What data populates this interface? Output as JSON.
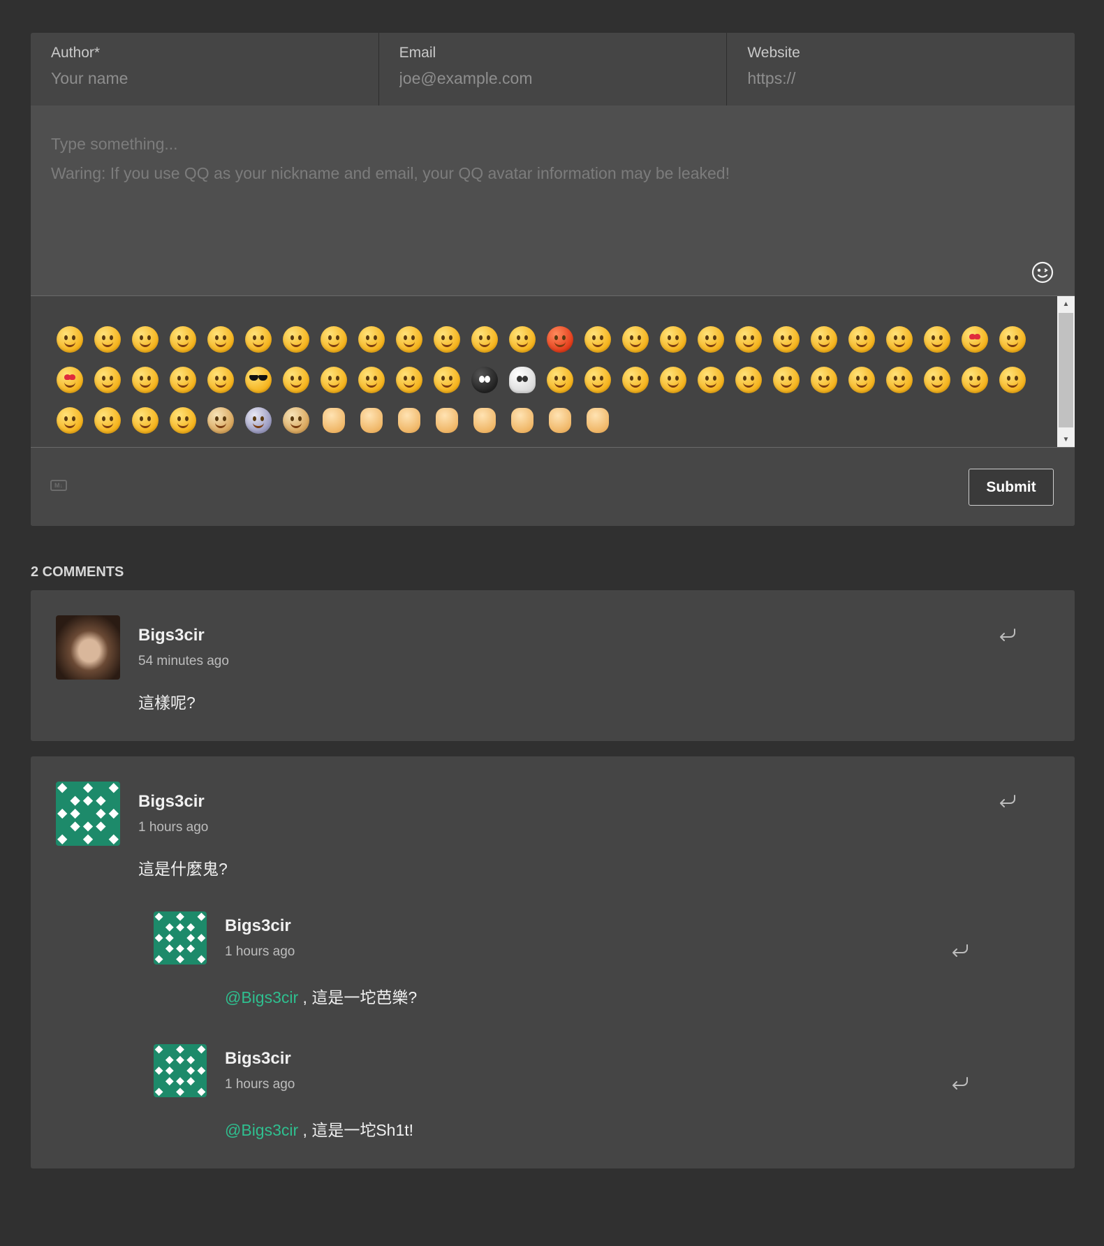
{
  "form": {
    "fields": [
      {
        "label": "Author*",
        "placeholder": "Your name"
      },
      {
        "label": "Email",
        "placeholder": "joe@example.com"
      },
      {
        "label": "Website",
        "placeholder": "https://"
      }
    ],
    "textarea_placeholder": "Type something...\nWaring: If you use QQ as your nickname and email, your QQ avatar information may be leaked!",
    "emoji_toggle_icon": "smiley-face-icon",
    "markdown_icon": "markdown-icon",
    "submit_label": "Submit"
  },
  "emoji_panel": {
    "scroll_position": 0,
    "emoji_count": 67
  },
  "comments": {
    "count_label": "2 COMMENTS",
    "accent_color": "#2fbf8f",
    "items": [
      {
        "author": "Bigs3cir",
        "time": "54 minutes ago",
        "avatar": "photo-avatar",
        "text": "這樣呢?"
      },
      {
        "author": "Bigs3cir",
        "time": "1 hours ago",
        "avatar": "identicon-avatar",
        "text": "這是什麼鬼?",
        "replies": [
          {
            "author": "Bigs3cir",
            "time": "1 hours ago",
            "mention": "@Bigs3cir",
            "text": " , 這是一坨芭樂?"
          },
          {
            "author": "Bigs3cir",
            "time": "1 hours ago",
            "mention": "@Bigs3cir",
            "text": " , 這是一坨Sh1t!"
          }
        ]
      }
    ]
  }
}
